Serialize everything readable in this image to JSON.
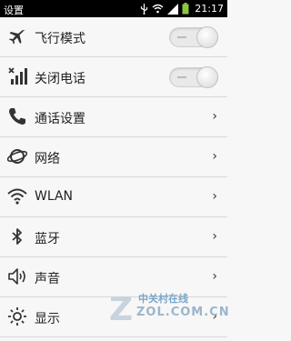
{
  "status_bar": {
    "title": "设置",
    "time": "21:17",
    "icons": [
      "usb-icon",
      "wifi-icon",
      "signal-icon",
      "battery-icon"
    ]
  },
  "settings": {
    "items": [
      {
        "label": "飞行模式",
        "icon": "airplane-icon",
        "control": "toggle",
        "state": "off"
      },
      {
        "label": "关闭电话",
        "icon": "signal-x-icon",
        "control": "toggle",
        "state": "off"
      },
      {
        "label": "通话设置",
        "icon": "phone-icon",
        "control": "chevron"
      },
      {
        "label": "网络",
        "icon": "globe-icon",
        "control": "chevron"
      },
      {
        "label": "WLAN",
        "icon": "wifi-icon",
        "control": "chevron"
      },
      {
        "label": "蓝牙",
        "icon": "bluetooth-icon",
        "control": "chevron"
      },
      {
        "label": "声音",
        "icon": "speaker-icon",
        "control": "chevron"
      },
      {
        "label": "显示",
        "icon": "brightness-icon",
        "control": "chevron"
      }
    ]
  },
  "chevron_glyph": "›",
  "watermark": {
    "title": "中关村在线",
    "url": "ZOL.COM.CN"
  }
}
